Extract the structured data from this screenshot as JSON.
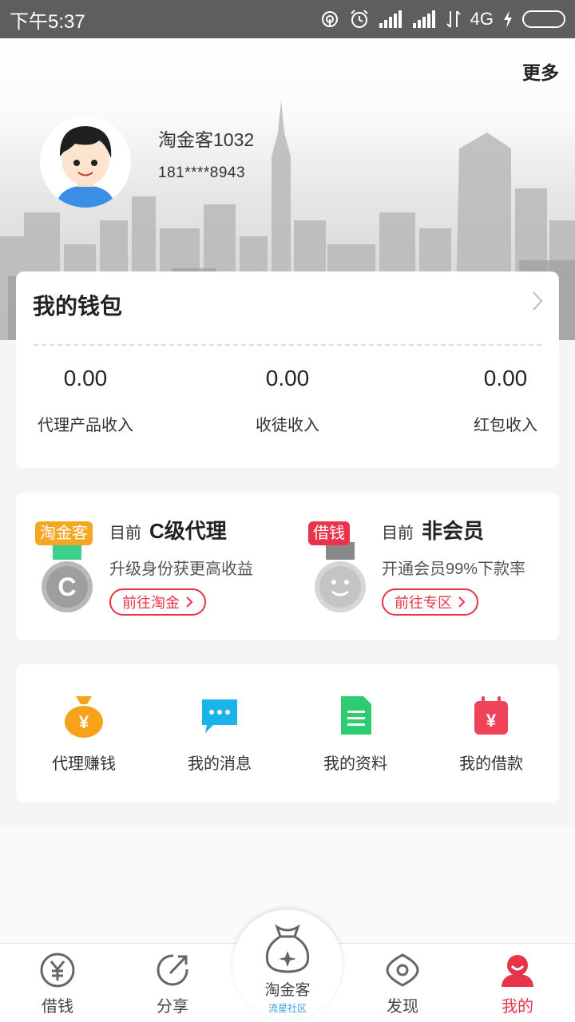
{
  "status_bar": {
    "time": "下午5:37",
    "network": "4G",
    "battery_level": 0.38,
    "icons": [
      "hotspot-icon",
      "alarm-icon",
      "signal-icon",
      "signal-icon",
      "data-arrows-icon",
      "charging-icon",
      "battery-icon"
    ]
  },
  "header": {
    "more_label": "更多",
    "username": "淘金客1032",
    "phone": "181****8943"
  },
  "wallet": {
    "title": "我的钱包",
    "items": [
      {
        "value": "0.00",
        "label": "代理产品收入"
      },
      {
        "value": "0.00",
        "label": "收徒收入"
      },
      {
        "value": "0.00",
        "label": "红包收入"
      }
    ]
  },
  "membership": [
    {
      "tag": "淘金客",
      "prefix": "目前",
      "level": "C级代理",
      "desc": "升级身份获更高收益",
      "button": "前往淘金",
      "tag_color": "#f5a623"
    },
    {
      "tag": "借钱",
      "prefix": "目前",
      "level": "非会员",
      "desc": "开通会员99%下款率",
      "button": "前往专区",
      "tag_color": "#e8344a"
    }
  ],
  "shortcuts": [
    {
      "label": "代理赚钱",
      "icon": "money-bag-icon",
      "color": "#f7a21b"
    },
    {
      "label": "我的消息",
      "icon": "message-icon",
      "color": "#1ab4e8"
    },
    {
      "label": "我的资料",
      "icon": "document-icon",
      "color": "#2ecc71"
    },
    {
      "label": "我的借款",
      "icon": "loan-calendar-icon",
      "color": "#f0435a"
    }
  ],
  "tabbar": {
    "tabs": [
      {
        "label": "借钱",
        "icon": "yen-icon"
      },
      {
        "label": "分享",
        "icon": "share-icon"
      },
      {
        "label": "淘金客",
        "icon": "treasure-bag-icon",
        "sub": "流星社区"
      },
      {
        "label": "发现",
        "icon": "eye-icon"
      },
      {
        "label": "我的",
        "icon": "profile-icon"
      }
    ],
    "active": "我的",
    "accent": "#e8344a"
  }
}
